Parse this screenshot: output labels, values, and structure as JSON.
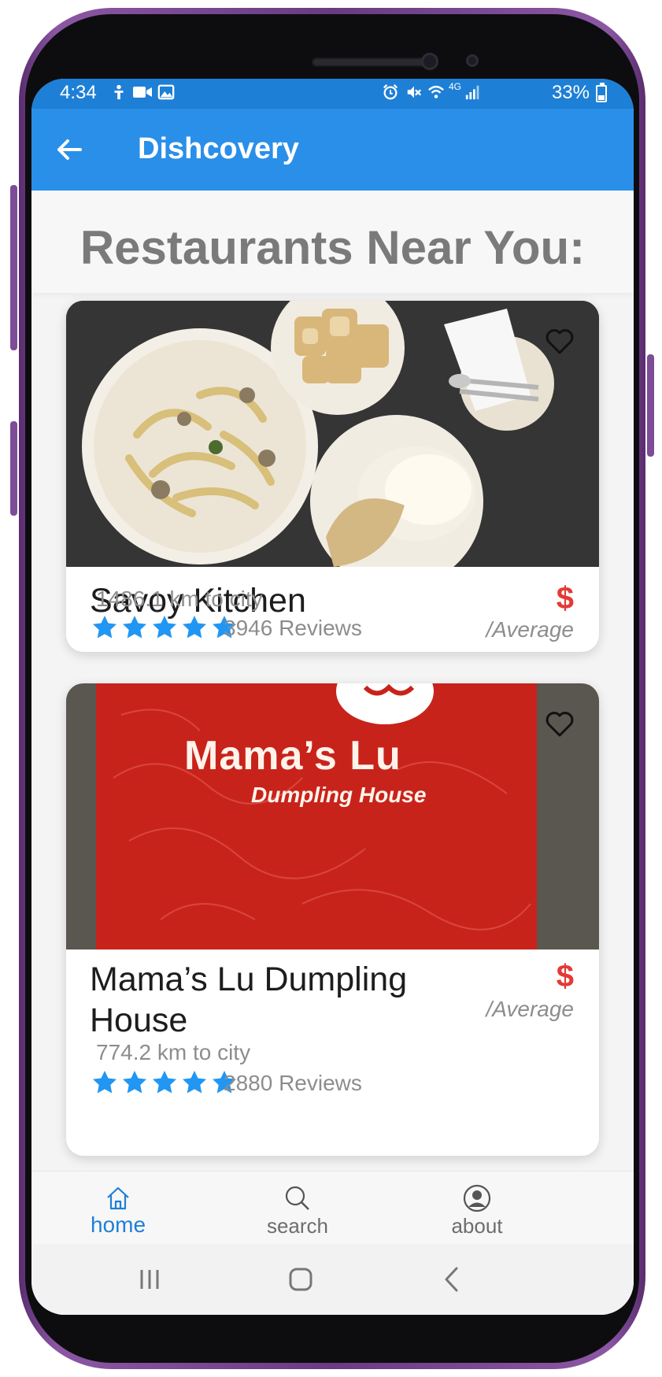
{
  "status_bar": {
    "time": "4:34",
    "battery": "33%",
    "network": "4G"
  },
  "app_bar": {
    "title": "Dishcovery"
  },
  "page": {
    "heading": "Restaurants Near You:"
  },
  "restaurants": [
    {
      "name": "Savoy Kitchen",
      "price": "$",
      "price_label": "/Average",
      "distance": "1486.1 km to city",
      "rating": 5,
      "reviews": "3946 Reviews",
      "favorite": false
    },
    {
      "name": "Mama’s Lu Dumpling House",
      "price": "$",
      "price_label": "/Average",
      "distance": "774.2 km to city",
      "rating": 5,
      "reviews": "2880 Reviews",
      "favorite": false,
      "photo_text_1": "Mama’s Lu",
      "photo_text_2": "Dumpling House"
    }
  ],
  "bottom_nav": {
    "items": [
      {
        "label": "home"
      },
      {
        "label": "search"
      },
      {
        "label": "about"
      }
    ],
    "active": "home"
  },
  "colors": {
    "primary": "#2a8fe8",
    "status_bar": "#1e7fd6",
    "star": "#2196f3",
    "price": "#e53935"
  }
}
